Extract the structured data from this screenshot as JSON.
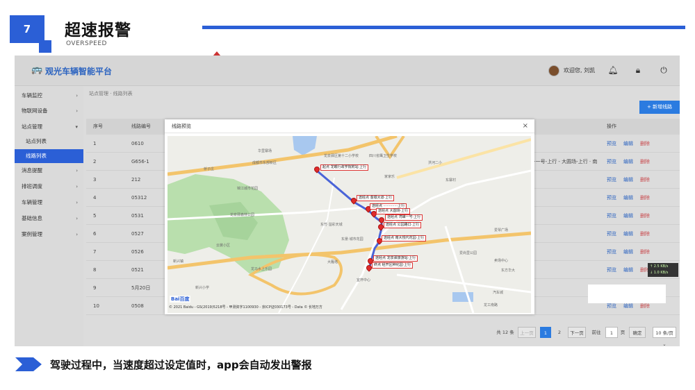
{
  "slide": {
    "number": "7",
    "title": "超速报警",
    "subtitle": "OVERSPEED",
    "caption": "驾驶过程中，当速度超过设定值时，app会自动发出警报"
  },
  "app": {
    "name": "观光车辆智能平台",
    "welcome": "欢迎您, 刘凯",
    "breadcrumb": "站点管理  ·  线路列表",
    "add_button": "+ 新增线路",
    "sidebar": [
      {
        "label": "车辆监控",
        "arrow": "›"
      },
      {
        "label": "物联网设备",
        "arrow": "›"
      },
      {
        "label": "站点管理",
        "arrow": "▾"
      },
      {
        "label": "站点列表",
        "arrow": ""
      },
      {
        "label": "线路列表",
        "arrow": ""
      },
      {
        "label": "消息提醒",
        "arrow": "›"
      },
      {
        "label": "排班调度",
        "arrow": "›"
      },
      {
        "label": "车辆管理",
        "arrow": "›"
      },
      {
        "label": "基础信息",
        "arrow": "›"
      },
      {
        "label": "案例管理",
        "arrow": "›"
      }
    ],
    "table": {
      "headers": {
        "index": "序号",
        "code": "线路编号",
        "ops": "操作"
      },
      "rows": [
        {
          "index": "1",
          "code": "0610",
          "extra": ""
        },
        {
          "index": "2",
          "code": "G656-1",
          "extra": "···一号-上行 - 大圆场-上行 · 南"
        },
        {
          "index": "3",
          "code": "212",
          "extra": ""
        },
        {
          "index": "4",
          "code": "05312",
          "extra": ""
        },
        {
          "index": "5",
          "code": "0531",
          "extra": ""
        },
        {
          "index": "6",
          "code": "0527",
          "extra": ""
        },
        {
          "index": "7",
          "code": "0526",
          "extra": ""
        },
        {
          "index": "8",
          "code": "0521",
          "extra": ""
        },
        {
          "index": "9",
          "code": "5月20日",
          "extra": ""
        },
        {
          "index": "10",
          "code": "0508",
          "extra": ""
        }
      ],
      "op_preview": "预览",
      "op_edit": "编辑",
      "op_delete": "删除"
    },
    "pager": {
      "total": "共 12 条",
      "prev": "上一页",
      "page1": "1",
      "page2": "2",
      "next": "下一页",
      "goto": "前往",
      "page_input": "1",
      "page_unit": "页",
      "confirm": "确定",
      "size": "10 条/页 ⌄"
    },
    "speed_badge": {
      "up": "↑ 2.5 KB/s",
      "down": "↓ 1.0 KB/s"
    }
  },
  "modal": {
    "title": "线路预览",
    "close": "×",
    "baidu": "Bai百度",
    "footer": "© 2021 Baidu - GS(2019)5218号 - 甲测资字1100930 - 京ICP证030173号 - Data © 长地万方",
    "stops": [
      "起点 龙眼行政学院附站·上行",
      "途经点 金银大道·上行",
      "途经点 ·············上行",
      "途经点 大圆场·上行",
      "途经点 湾嵘一号·上行",
      "途经点 公园路口·上行",
      "途经点 南大悦代花园·上行",
      "途经点 龙泉驿旅游站·上行",
      "终点 经开区种化园·上行"
    ],
    "places": [
      "华里寨场",
      "龙泉驿区第十二小学校",
      "四川省鹰卫生学校",
      "洪河二小",
      "东寨村",
      "成都市东部新区",
      "桥子庄",
      "锦江城市花园",
      "家家乐",
      "龙泉驿森林公园",
      "东竹·溢彩天城",
      "东景·城市花园",
      "龙马水上乐园",
      "云裳小区",
      "新兴镇",
      "新兴小学",
      "大雁塔",
      "爱琴广场",
      "爱尚里公园",
      "卖场中心",
      "东方华大",
      "宜杯中心",
      "龙工南路",
      "汽车城"
    ]
  },
  "colors": {
    "accent": "#2b5fd6",
    "route": "#4a64d8",
    "pin": "#e02b2b"
  }
}
